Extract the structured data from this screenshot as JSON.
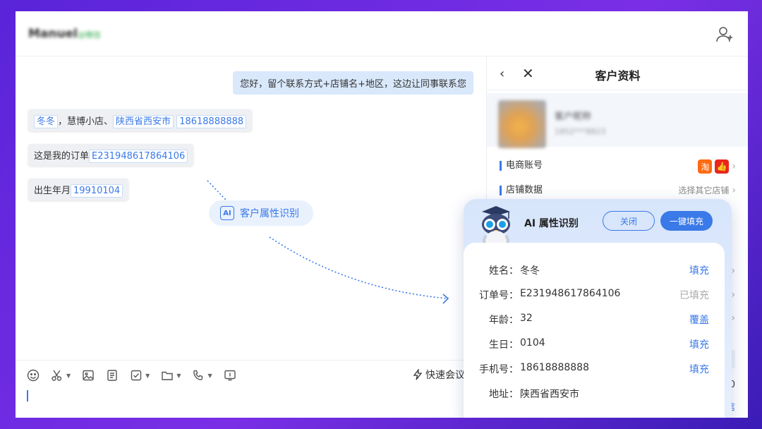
{
  "header": {
    "contact_name": "Manuel",
    "contact_tag": "@微信"
  },
  "chat": {
    "outgoing": "您好，留个联系方式+店铺名+地区，这边让同事联系您",
    "msg1": {
      "name": "冬冬",
      "sep1": "，慧博小店、",
      "region": "陕西省西安市",
      "phone": "18618888888"
    },
    "msg2": {
      "prefix": "这是我的订单",
      "order": "E231948617864106"
    },
    "msg3": {
      "prefix": "出生年月",
      "birth": "19910104"
    },
    "ai_chip": {
      "icon": "AI",
      "label": "客户属性识别"
    }
  },
  "toolbar": {
    "quick_meeting": "快速会议"
  },
  "panel": {
    "title": "客户资料",
    "profile_name": "客户昵称",
    "profile_id": "1852***8823",
    "rows": [
      {
        "label": "电商账号",
        "right": ""
      },
      {
        "label": "店铺数据",
        "right": "选择其它店铺"
      }
    ],
    "side_num": "20",
    "side_link": "信"
  },
  "ai_card": {
    "title": "AI 属性识别",
    "close_label": "关闭",
    "fill_all_label": "一键填充",
    "fields": [
      {
        "key": "姓名：",
        "value": "冬冬",
        "action": "填充",
        "done": false
      },
      {
        "key": "订单号：",
        "value": "E231948617864106",
        "action": "已填充",
        "done": true
      },
      {
        "key": "年龄：",
        "value": "32",
        "action": "覆盖",
        "done": false
      },
      {
        "key": "生日：",
        "value": "0104",
        "action": "填充",
        "done": false
      },
      {
        "key": "手机号：",
        "value": "18618888888",
        "action": "填充",
        "done": false
      },
      {
        "key": "地址：",
        "value": "陕西省西安市",
        "action": "",
        "done": false
      }
    ]
  },
  "colors": {
    "accent": "#3a79e8",
    "bubble_out": "#d9e8fb",
    "bubble_in": "#eef0f3",
    "taobao": "#ff6a10",
    "douyin": "#e9261e"
  }
}
